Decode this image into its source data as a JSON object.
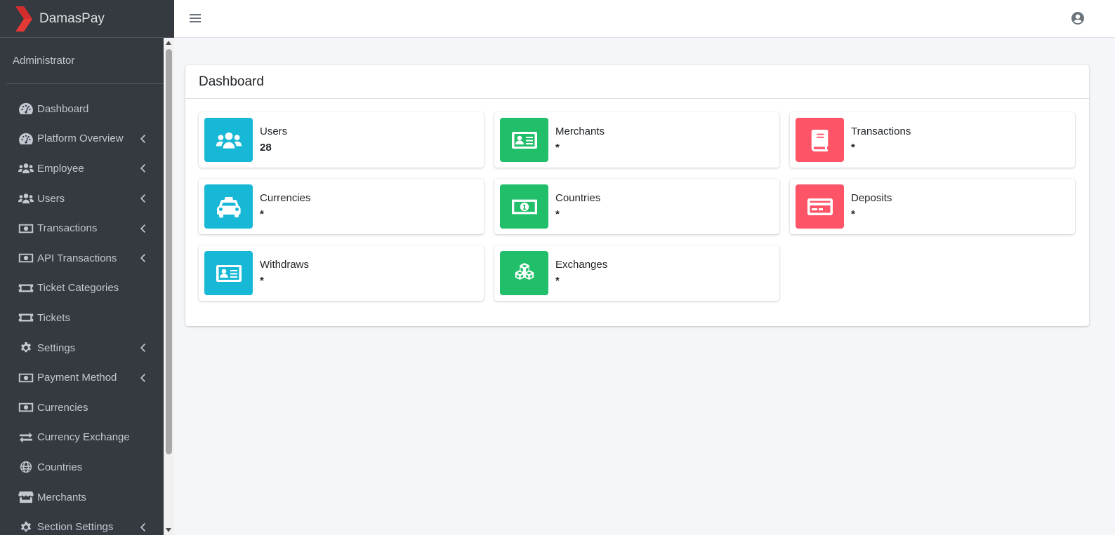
{
  "brand": {
    "name": "DamasPay",
    "logo_color": "#e53935"
  },
  "user_panel": {
    "name": "Administrator"
  },
  "sidebar": {
    "items": [
      {
        "label": "Dashboard",
        "icon": "tachometer-icon",
        "has_children": false
      },
      {
        "label": "Platform Overview",
        "icon": "tachometer-icon",
        "has_children": true
      },
      {
        "label": "Employee",
        "icon": "users-icon",
        "has_children": true
      },
      {
        "label": "Users",
        "icon": "users-icon",
        "has_children": true
      },
      {
        "label": "Transactions",
        "icon": "money-bill-icon",
        "has_children": true
      },
      {
        "label": "API Transactions",
        "icon": "money-bill-icon",
        "has_children": true
      },
      {
        "label": "Ticket Categories",
        "icon": "ticket-icon",
        "has_children": false
      },
      {
        "label": "Tickets",
        "icon": "ticket-icon",
        "has_children": false
      },
      {
        "label": "Settings",
        "icon": "gear-icon",
        "has_children": true
      },
      {
        "label": "Payment Method",
        "icon": "money-bill-icon",
        "has_children": true
      },
      {
        "label": "Currencies",
        "icon": "money-bill-icon",
        "has_children": false
      },
      {
        "label": "Currency Exchange",
        "icon": "exchange-icon",
        "has_children": false
      },
      {
        "label": "Countries",
        "icon": "globe-icon",
        "has_children": false
      },
      {
        "label": "Merchants",
        "icon": "store-icon",
        "has_children": false
      },
      {
        "label": "Section Settings",
        "icon": "gear-icon",
        "has_children": true
      }
    ]
  },
  "topbar": {
    "menu_icon": "hamburger-icon",
    "user_icon": "user-circle-icon"
  },
  "dashboard": {
    "title": "Dashboard",
    "boxes": [
      {
        "label": "Users",
        "value": "28",
        "color": "#17b8d6",
        "icon": "users-icon"
      },
      {
        "label": "Merchants",
        "value": "*",
        "color": "#22bf6a",
        "icon": "id-card-icon"
      },
      {
        "label": "Transactions",
        "value": "*",
        "color": "#fd5467",
        "icon": "book-icon"
      },
      {
        "label": "Currencies",
        "value": "*",
        "color": "#17b8d6",
        "icon": "taxi-icon"
      },
      {
        "label": "Countries",
        "value": "*",
        "color": "#22bf6a",
        "icon": "money-bill-icon"
      },
      {
        "label": "Deposits",
        "value": "*",
        "color": "#fd5467",
        "icon": "credit-card-icon"
      },
      {
        "label": "Withdraws",
        "value": "*",
        "color": "#17b8d6",
        "icon": "id-card-icon"
      },
      {
        "label": "Exchanges",
        "value": "*",
        "color": "#22bf6a",
        "icon": "cubes-icon"
      }
    ]
  }
}
